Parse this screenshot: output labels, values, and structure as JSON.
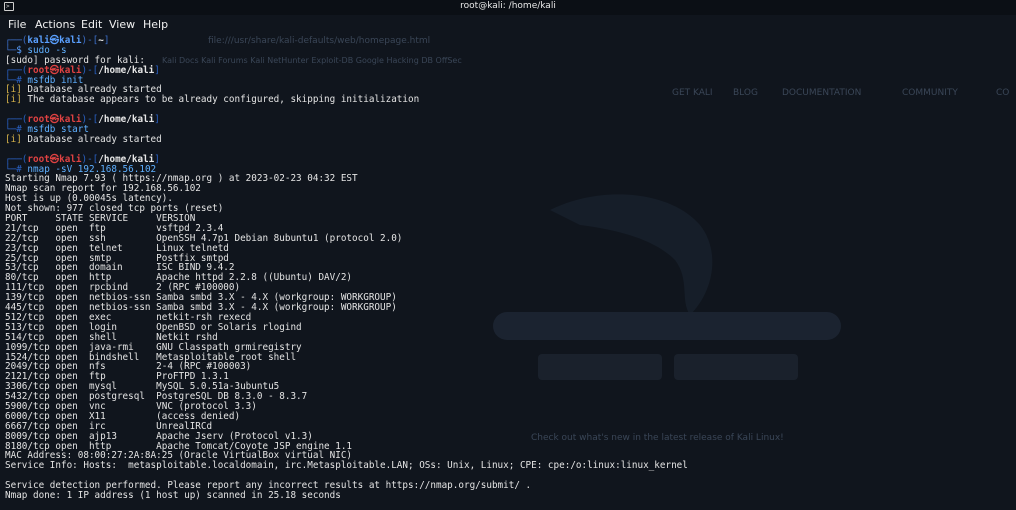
{
  "window": {
    "title": "root@kali: /home/kali",
    "icon": "terminal-icon"
  },
  "menu": [
    "File",
    "Actions",
    "Edit",
    "View",
    "Help"
  ],
  "background_ghost": {
    "url": "file:///usr/share/kali-defaults/web/homepage.html",
    "bookmarks": "Kali Docs   Kali Forums   Kali NetHunter   Exploit-DB   Google Hacking DB   OffSec",
    "nav": [
      "GET KALI",
      "BLOG",
      "DOCUMENTATION",
      "COMMUNITY",
      "CO"
    ],
    "tagline": "Check out what's new in the latest release of Kali Linux!"
  },
  "terminal": {
    "prompt_user_kali": "kali",
    "prompt_user_root": "root",
    "host": "kali",
    "home_dir": "~",
    "root_dir": "/home/kali",
    "sessions": [
      {
        "user": "kali",
        "dir": "~",
        "command": "sudo -s",
        "output": [
          {
            "kind": "plain",
            "text": "[sudo] password for kali:"
          }
        ]
      },
      {
        "user": "root",
        "dir": "/home/kali",
        "command": "msfdb init",
        "output": [
          {
            "kind": "info",
            "text": "Database already started"
          },
          {
            "kind": "info",
            "text": "The database appears to be already configured, skipping initialization"
          },
          {
            "kind": "blank",
            "text": ""
          }
        ]
      },
      {
        "user": "root",
        "dir": "/home/kali",
        "command": "msfdb start",
        "output": [
          {
            "kind": "info",
            "text": "Database already started"
          },
          {
            "kind": "blank",
            "text": ""
          }
        ]
      },
      {
        "user": "root",
        "dir": "/home/kali",
        "command": "nmap -sV 192.168.56.102",
        "output": [
          {
            "kind": "plain",
            "text": "Starting Nmap 7.93 ( https://nmap.org ) at 2023-02-23 04:32 EST"
          },
          {
            "kind": "plain",
            "text": "Nmap scan report for 192.168.56.102"
          },
          {
            "kind": "plain",
            "text": "Host is up (0.00045s latency)."
          },
          {
            "kind": "plain",
            "text": "Not shown: 977 closed tcp ports (reset)"
          },
          {
            "kind": "plain",
            "text": "PORT     STATE SERVICE     VERSION"
          },
          {
            "kind": "plain",
            "text": "21/tcp   open  ftp         vsftpd 2.3.4"
          },
          {
            "kind": "plain",
            "text": "22/tcp   open  ssh         OpenSSH 4.7p1 Debian 8ubuntu1 (protocol 2.0)"
          },
          {
            "kind": "plain",
            "text": "23/tcp   open  telnet      Linux telnetd"
          },
          {
            "kind": "plain",
            "text": "25/tcp   open  smtp        Postfix smtpd"
          },
          {
            "kind": "plain",
            "text": "53/tcp   open  domain      ISC BIND 9.4.2"
          },
          {
            "kind": "plain",
            "text": "80/tcp   open  http        Apache httpd 2.2.8 ((Ubuntu) DAV/2)"
          },
          {
            "kind": "plain",
            "text": "111/tcp  open  rpcbind     2 (RPC #100000)"
          },
          {
            "kind": "plain",
            "text": "139/tcp  open  netbios-ssn Samba smbd 3.X - 4.X (workgroup: WORKGROUP)"
          },
          {
            "kind": "plain",
            "text": "445/tcp  open  netbios-ssn Samba smbd 3.X - 4.X (workgroup: WORKGROUP)"
          },
          {
            "kind": "plain",
            "text": "512/tcp  open  exec        netkit-rsh rexecd"
          },
          {
            "kind": "plain",
            "text": "513/tcp  open  login       OpenBSD or Solaris rlogind"
          },
          {
            "kind": "plain",
            "text": "514/tcp  open  shell       Netkit rshd"
          },
          {
            "kind": "plain",
            "text": "1099/tcp open  java-rmi    GNU Classpath grmiregistry"
          },
          {
            "kind": "plain",
            "text": "1524/tcp open  bindshell   Metasploitable root shell"
          },
          {
            "kind": "plain",
            "text": "2049/tcp open  nfs         2-4 (RPC #100003)"
          },
          {
            "kind": "plain",
            "text": "2121/tcp open  ftp         ProFTPD 1.3.1"
          },
          {
            "kind": "plain",
            "text": "3306/tcp open  mysql       MySQL 5.0.51a-3ubuntu5"
          },
          {
            "kind": "plain",
            "text": "5432/tcp open  postgresql  PostgreSQL DB 8.3.0 - 8.3.7"
          },
          {
            "kind": "plain",
            "text": "5900/tcp open  vnc         VNC (protocol 3.3)"
          },
          {
            "kind": "plain",
            "text": "6000/tcp open  X11         (access denied)"
          },
          {
            "kind": "plain",
            "text": "6667/tcp open  irc         UnrealIRCd"
          },
          {
            "kind": "plain",
            "text": "8009/tcp open  ajp13       Apache Jserv (Protocol v1.3)"
          },
          {
            "kind": "plain",
            "text": "8180/tcp open  http        Apache Tomcat/Coyote JSP engine 1.1"
          },
          {
            "kind": "plain",
            "text": "MAC Address: 08:00:27:2A:8A:25 (Oracle VirtualBox virtual NIC)"
          },
          {
            "kind": "plain",
            "text": "Service Info: Hosts:  metasploitable.localdomain, irc.Metasploitable.LAN; OSs: Unix, Linux; CPE: cpe:/o:linux:linux_kernel"
          },
          {
            "kind": "blank",
            "text": ""
          },
          {
            "kind": "plain",
            "text": "Service detection performed. Please report any incorrect results at https://nmap.org/submit/ ."
          },
          {
            "kind": "plain",
            "text": "Nmap done: 1 IP address (1 host up) scanned in 25.18 seconds"
          }
        ]
      }
    ]
  },
  "colors": {
    "background": "#10151d",
    "prompt_box": "#3c6fc9",
    "kali_user": "#5aa0ff",
    "root_user": "#e04242",
    "command": "#5fb0ff",
    "info_tag": "#d7b34a",
    "text": "#e4e4e4"
  }
}
